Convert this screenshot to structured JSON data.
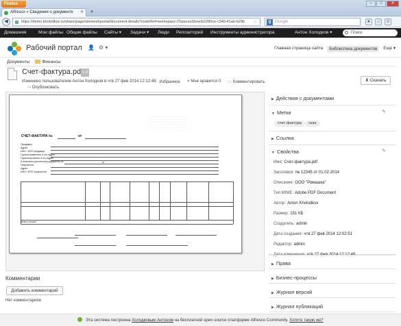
{
  "browser": {
    "app_button": "Firefox",
    "tab_title": "Alfresco » Сведения о документе",
    "url": "https://demo.kholodkov.ru/share/page/site/workportal/document-details?nodeRef=workspace://SpacesStore/b2280ce-c340-41ab-b29b",
    "search_placeholder": "Google"
  },
  "appbar": {
    "items": [
      "Домашняя",
      "Мои файлы",
      "Общие файлы",
      "Сайты ▾",
      "Задачи ▾",
      "Люди",
      "Репозиторий",
      "Инструменты администратора"
    ],
    "user": "Антон Холодков ▾",
    "search_placeholder": "Поиск"
  },
  "site": {
    "title": "Рабочий портал",
    "links": [
      "Главная страница сайта",
      "Библиотека документов",
      "Еще ▾"
    ]
  },
  "breadcrumb": {
    "root": "Документы",
    "folder": "Финансы"
  },
  "document": {
    "title": "Счет-фактура.pdf",
    "version": "1.0",
    "modified": "Изменено пользователем Антон Холодков в чтв 27 фев 2014 12:12:48",
    "favorite": "Избранное",
    "like": "Мне нравится",
    "like_count": "0",
    "comment": "Комментировать",
    "publish": "Опубликовать",
    "download": "Скачать"
  },
  "preview": {
    "invoice_title": "СЧЕТ-ФАКТУРА №",
    "from_label": "от",
    "fields": [
      "Продавец",
      "Адрес",
      "ИНН / КПП продавца",
      "Грузоотправитель и его адрес",
      "Грузополучатель и его адрес",
      "К платежно-расчетному документу №",
      "Покупатель",
      "Адрес",
      "ИНН / КПП покупателя"
    ],
    "from_short": "от",
    "total_label": "Всего к оплате"
  },
  "comments": {
    "heading": "Комментарии",
    "add_button": "Добавить комментарий",
    "empty": "Нет комментариев"
  },
  "sidebar": {
    "actions": "Действия с документами",
    "tags_heading": "Метки",
    "tags": [
      "счет-фактура",
      "скан"
    ],
    "link": "Ссылка",
    "properties_heading": "Свойства",
    "properties": [
      {
        "label": "Имя:",
        "value": "Счет-фактура.pdf"
      },
      {
        "label": "Заголовок:",
        "value": "№ 12345 от 01.02.2014"
      },
      {
        "label": "Описание:",
        "value": "ООО \"Ромашка\""
      },
      {
        "label": "Тип MIME:",
        "value": "Adobe PDF Document"
      },
      {
        "label": "Автор:",
        "value": "Anton Kholodkov"
      },
      {
        "label": "Размер:",
        "value": "151 КБ"
      },
      {
        "label": "Создатель:",
        "value": "admin"
      },
      {
        "label": "Дата создания:",
        "value": "чтв 27 фев 2014 12:02:51"
      },
      {
        "label": "Редактор:",
        "value": "admin"
      },
      {
        "label": "Дата изменения:",
        "value": "чтв 27 фев 2014 12:12:48"
      }
    ],
    "rights": "Права",
    "business": "Бизнес-процессы",
    "versions": "Журнал версий",
    "publications": "Журнал публикаций"
  },
  "footer": {
    "prefix": "Эта система построена",
    "author": "Холодковым Антоном",
    "middle": "на бесплатной open-source платформе Alfresco Community.",
    "cta": "Хотите такую же?"
  },
  "colors": {
    "appbar": "#1f1f1f",
    "firefox_orange": "#e3760f"
  }
}
